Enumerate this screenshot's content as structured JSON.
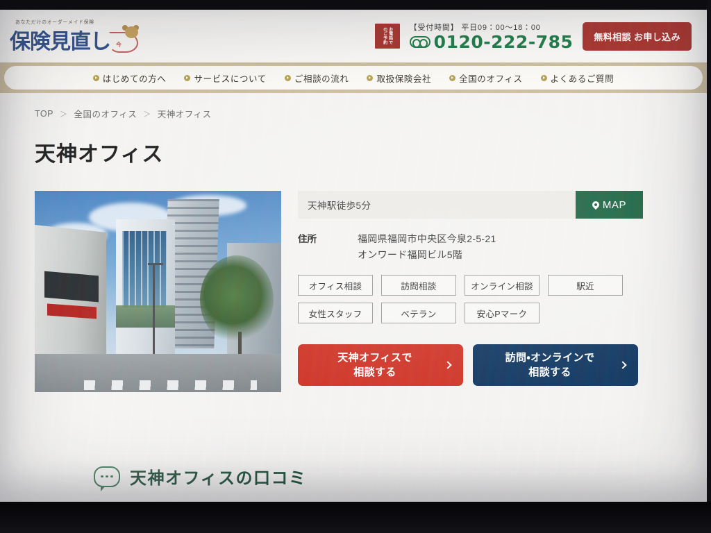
{
  "header": {
    "logo_tagline": "あなただけのオーダーメイド保険",
    "logo_text": "保険見直し",
    "logo_badge_text": "今",
    "tel_badge_label": "お電話でのご予約",
    "tel_hours": "【受付時間】 平日09：00〜18：00",
    "tel_number": "0120-222-785",
    "freedial_icon": "freedial-icon",
    "apply_button": "無料相談 お申し込み"
  },
  "nav": {
    "items": [
      {
        "label": "はじめての方へ",
        "icon": "arrow-dot-icon"
      },
      {
        "label": "サービスについて",
        "icon": "arrow-dot-icon"
      },
      {
        "label": "ご相談の流れ",
        "icon": "arrow-dot-icon"
      },
      {
        "label": "取扱保険会社",
        "icon": "arrow-dot-icon"
      },
      {
        "label": "全国のオフィス",
        "icon": "arrow-dot-icon"
      },
      {
        "label": "よくあるご質問",
        "icon": "arrow-dot-icon"
      }
    ]
  },
  "breadcrumb": {
    "items": [
      "TOP",
      "全国のオフィス",
      "天神オフィス"
    ],
    "separator": "＞"
  },
  "page": {
    "title": "天神オフィス"
  },
  "office": {
    "photo_alt": "天神オフィス外観",
    "access": "天神駅徒歩5分",
    "map_button": "MAP",
    "map_icon": "map-pin-icon",
    "address_label": "住所",
    "address_line1": "福岡県福岡市中央区今泉2-5-21",
    "address_line2": "オンワード福岡ビル5階",
    "tags": [
      "オフィス相談",
      "訪問相談",
      "オンライン相談",
      "駅近",
      "女性スタッフ",
      "ベテラン",
      "安心Pマーク"
    ],
    "cta_primary_line1": "天神オフィスで",
    "cta_primary_line2": "相談する",
    "cta_secondary_line1": "訪問・オンラインで",
    "cta_secondary_line2": "相談する"
  },
  "reviews": {
    "title": "天神オフィスの口コミ",
    "icon": "speech-bubble-icon"
  },
  "colors": {
    "brand_red": "#a8322c",
    "cta_red": "#cf3427",
    "cta_navy": "#123862",
    "map_green": "#17613f",
    "tel_green": "#1d7a46",
    "nav_band": "#cdbd9e",
    "nav_dot": "#b5a14f",
    "reviews_green": "#1f4f3a"
  }
}
